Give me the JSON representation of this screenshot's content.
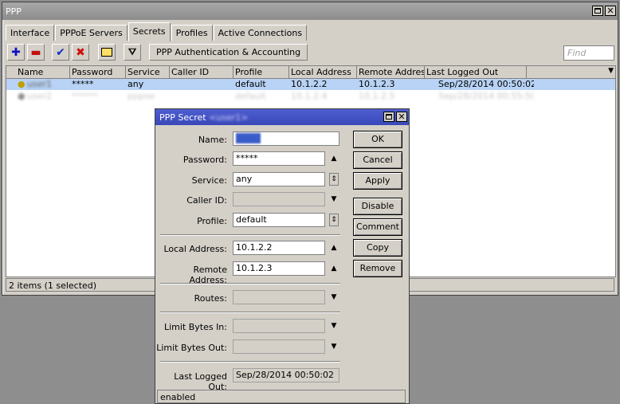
{
  "window": {
    "title": "PPP",
    "tabs": [
      "Interface",
      "PPPoE Servers",
      "Secrets",
      "Profiles",
      "Active Connections"
    ],
    "active_tab": "Secrets",
    "toolbar": {
      "auth_button": "PPP Authentication & Accounting",
      "find_placeholder": "Find"
    },
    "columns": [
      "Name",
      "Password",
      "Service",
      "Caller ID",
      "Profile",
      "Local Address",
      "Remote Address",
      "Last Logged Out"
    ],
    "rows": [
      {
        "name": "user1",
        "password": "*****",
        "service": "any",
        "caller_id": "",
        "profile": "default",
        "local_address": "10.1.2.2",
        "remote_address": "10.1.2.3",
        "last_logged_out": "Sep/28/2014 00:50:02"
      },
      {
        "name": "user2",
        "password": "******",
        "service": "pppoe",
        "caller_id": "",
        "profile": "default",
        "local_address": "10.1.2.4",
        "remote_address": "10.1.2.5",
        "last_logged_out": "Sep/28/2014 00:55:50"
      }
    ],
    "status": "2 items (1 selected)"
  },
  "dialog": {
    "title": "PPP Secret",
    "title_name": "<user1>",
    "fields": {
      "name_label": "Name:",
      "name_value": "user1",
      "password_label": "Password:",
      "password_value": "*****",
      "service_label": "Service:",
      "service_value": "any",
      "caller_id_label": "Caller ID:",
      "caller_id_value": "",
      "profile_label": "Profile:",
      "profile_value": "default",
      "local_address_label": "Local Address:",
      "local_address_value": "10.1.2.2",
      "remote_address_label": "Remote Address:",
      "remote_address_value": "10.1.2.3",
      "routes_label": "Routes:",
      "limit_in_label": "Limit Bytes In:",
      "limit_out_label": "Limit Bytes Out:",
      "last_logged_out_label": "Last Logged Out:",
      "last_logged_out_value": "Sep/28/2014 00:50:02"
    },
    "buttons": {
      "ok": "OK",
      "cancel": "Cancel",
      "apply": "Apply",
      "disable": "Disable",
      "comment": "Comment",
      "copy": "Copy",
      "remove": "Remove"
    },
    "status": "enabled"
  },
  "colors": {
    "selected_row": "#b8d3f5",
    "dialog_title": "#3a48b8",
    "add_icon": "#1010c0",
    "remove_icon": "#c01010"
  }
}
